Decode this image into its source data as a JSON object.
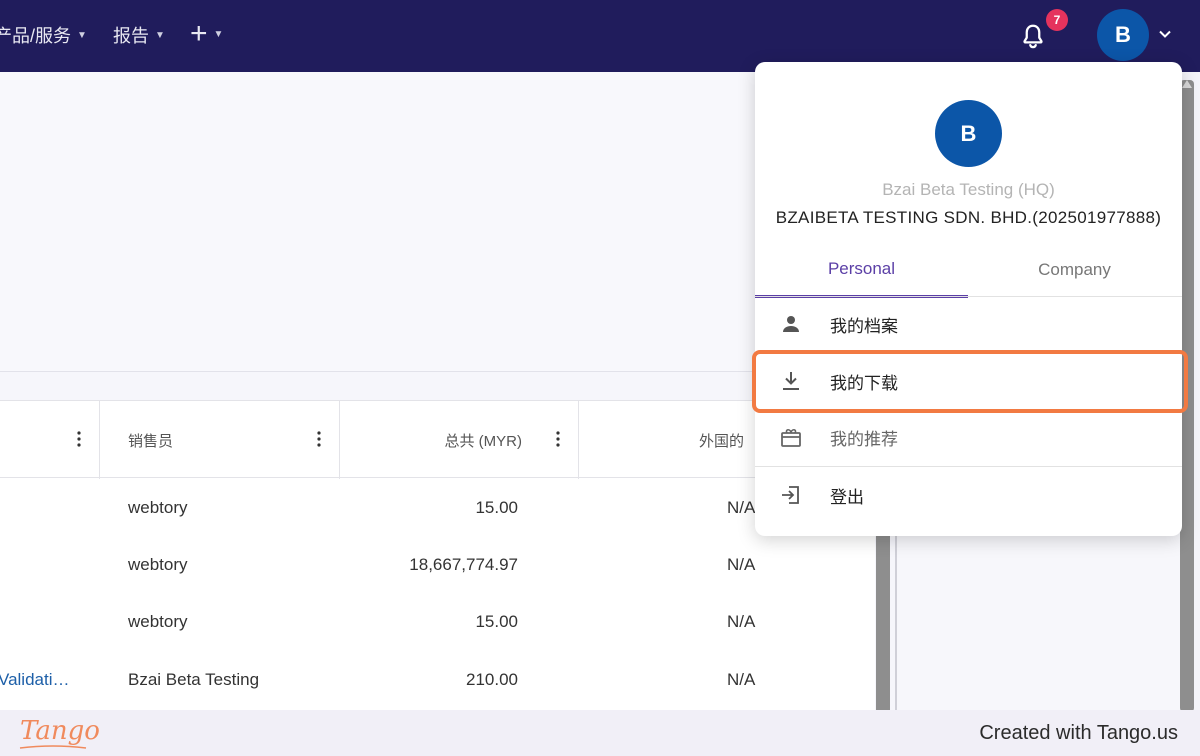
{
  "nav": {
    "items": [
      {
        "label": "产品/服务"
      },
      {
        "label": "报告"
      }
    ],
    "notification_count": "7",
    "user_initial": "B"
  },
  "table": {
    "columns": [
      {
        "label": ""
      },
      {
        "label": "销售员"
      },
      {
        "label": "总共 (MYR)"
      },
      {
        "label": "外国的"
      }
    ],
    "rows": [
      {
        "ref": "",
        "salesperson": "webtory",
        "total": "15.00",
        "foreign": "N/A"
      },
      {
        "ref": "",
        "salesperson": "webtory",
        "total": "18,667,774.97",
        "foreign": "N/A"
      },
      {
        "ref": "",
        "salesperson": "webtory",
        "total": "15.00",
        "foreign": "N/A"
      },
      {
        "ref": "Validati…",
        "salesperson": "Bzai Beta Testing",
        "total": "210.00",
        "foreign": "N/A"
      }
    ]
  },
  "dropdown": {
    "avatar_initial": "B",
    "branch_name": "Bzai Beta Testing (HQ)",
    "company_name": "BZAIBETA TESTING SDN. BHD.(202501977888)",
    "tabs": [
      {
        "label": "Personal",
        "active": true
      },
      {
        "label": "Company",
        "active": false
      }
    ],
    "menu": [
      {
        "label": "我的档案",
        "icon": "person-icon"
      },
      {
        "label": "我的下载",
        "icon": "download-icon"
      },
      {
        "label": "我的推荐",
        "icon": "gift-icon"
      },
      {
        "label": "登出",
        "icon": "logout-icon"
      }
    ]
  },
  "footer": {
    "logo": "Tango",
    "credit": "Created with Tango.us"
  },
  "colors": {
    "nav_bg": "#201c5c",
    "avatar_bg": "#0c56a8",
    "badge": "#e5335d",
    "tab_active": "#5b3fa6",
    "highlight": "#f27a42"
  }
}
